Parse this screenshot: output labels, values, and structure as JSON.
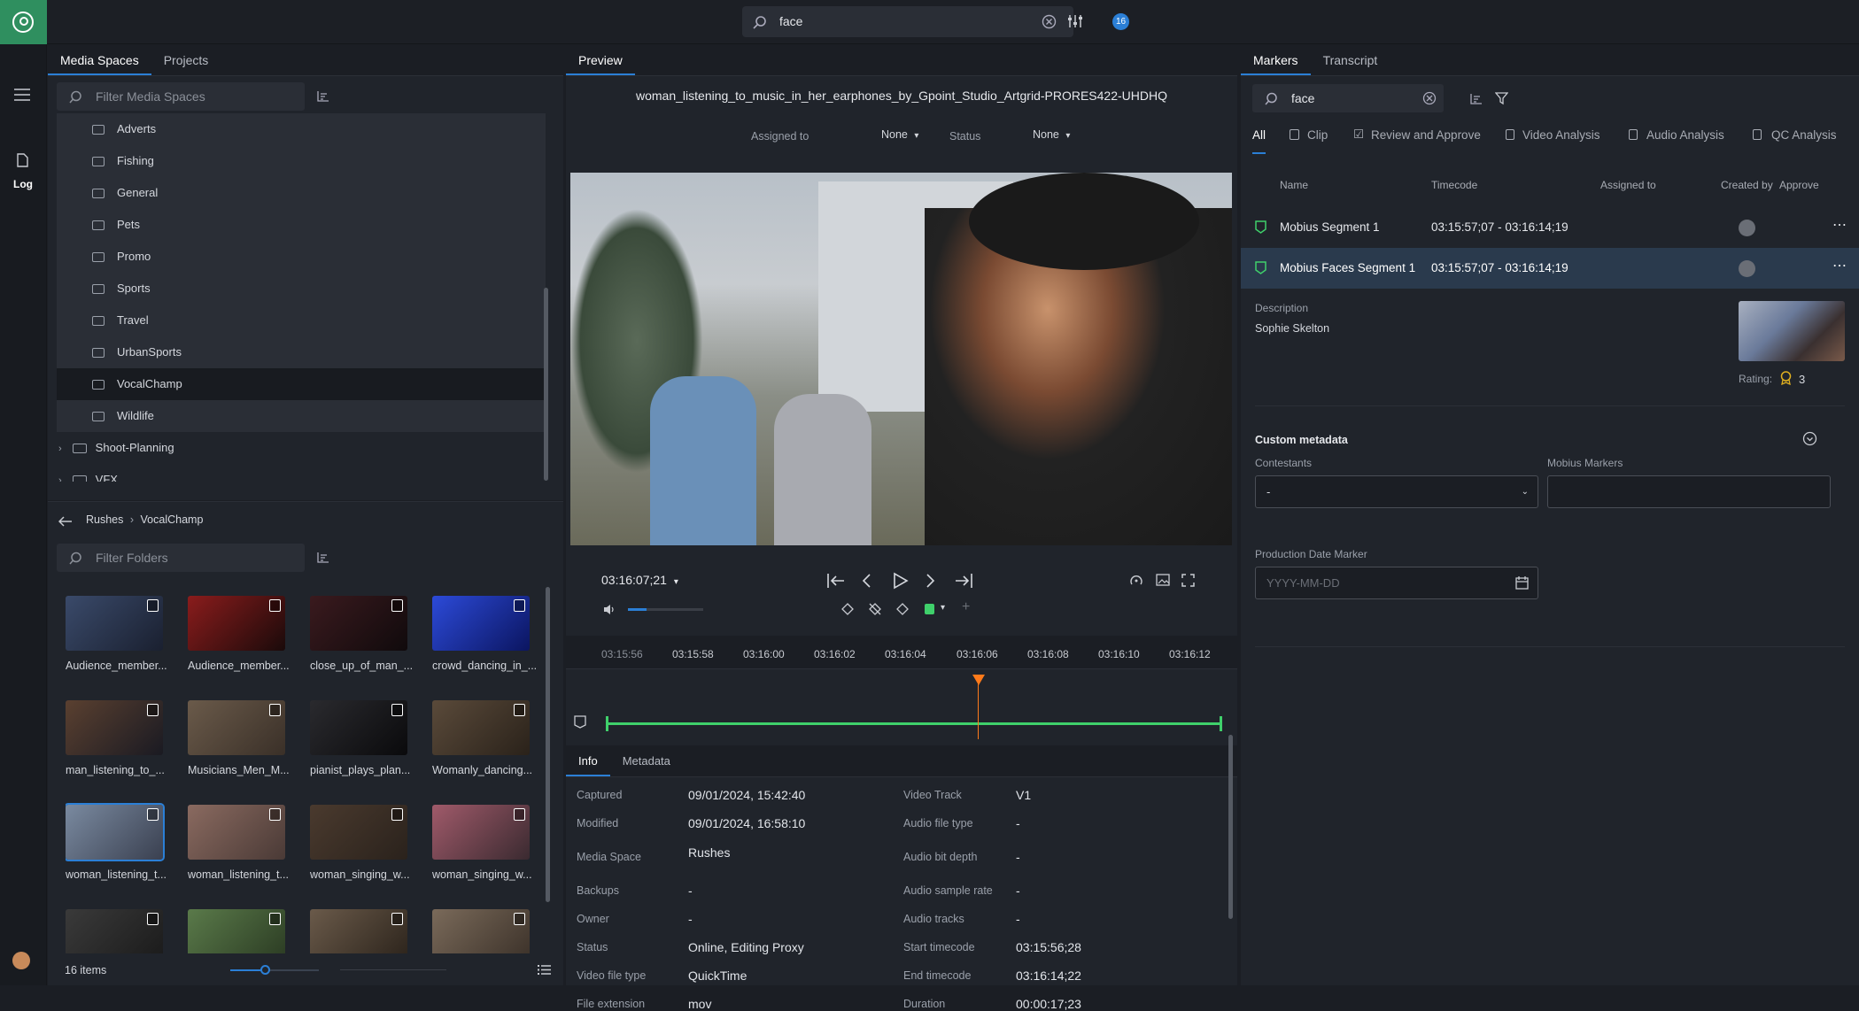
{
  "search": {
    "value": "face",
    "badge": "16"
  },
  "rail": {
    "log_label": "Log"
  },
  "left": {
    "tabs": [
      "Media Spaces",
      "Projects"
    ],
    "filter_placeholder": "Filter Media Spaces",
    "folders": [
      "Adverts",
      "Fishing",
      "General",
      "Pets",
      "Promo",
      "Sports",
      "Travel",
      "UrbanSports",
      "VocalChamp",
      "Wildlife"
    ],
    "groups": [
      "Shoot-Planning",
      "VFX"
    ],
    "breadcrumb": [
      "Rushes",
      "VocalChamp"
    ],
    "folder_filter_placeholder": "Filter Folders",
    "thumbs": [
      {
        "caption": "Audience_member...",
        "c1": "#3a4a6a",
        "c2": "#1a2030"
      },
      {
        "caption": "Audience_member...",
        "c1": "#8a1c1c",
        "c2": "#1a0a0a"
      },
      {
        "caption": "close_up_of_man_...",
        "c1": "#3a1a1e",
        "c2": "#100a0c"
      },
      {
        "caption": "crowd_dancing_in_...",
        "c1": "#2c4ad8",
        "c2": "#0b1560"
      },
      {
        "caption": "man_listening_to_...",
        "c1": "#5a4030",
        "c2": "#1a1a22"
      },
      {
        "caption": "Musicians_Men_M...",
        "c1": "#6a5a4a",
        "c2": "#3a3028"
      },
      {
        "caption": "pianist_plays_plan...",
        "c1": "#2a2a2e",
        "c2": "#0a0a0c"
      },
      {
        "caption": "Womanly_dancing...",
        "c1": "#5a4a3a",
        "c2": "#2a221a"
      },
      {
        "caption": "woman_listening_t...",
        "c1": "#7a8aa0",
        "c2": "#3a4050"
      },
      {
        "caption": "woman_listening_t...",
        "c1": "#8a6a60",
        "c2": "#4a3a36"
      },
      {
        "caption": "woman_singing_w...",
        "c1": "#4a3a2e",
        "c2": "#2a221c"
      },
      {
        "caption": "woman_singing_w...",
        "c1": "#a05a6a",
        "c2": "#3a2a30"
      },
      {
        "caption": "",
        "c1": "#3a3a3a",
        "c2": "#1a1a1a"
      },
      {
        "caption": "",
        "c1": "#5a7a4a",
        "c2": "#2a3a22"
      },
      {
        "caption": "",
        "c1": "#6a5a4a",
        "c2": "#2a221a"
      },
      {
        "caption": "",
        "c1": "#7a6a5a",
        "c2": "#3a3028"
      }
    ],
    "item_count": "16 items"
  },
  "preview": {
    "tab": "Preview",
    "title": "woman_listening_to_music_in_her_earphones_by_Gpoint_Studio_Artgrid-PRORES422-UHDHQ",
    "assigned_label": "Assigned to",
    "assigned_value": "None",
    "status_label": "Status",
    "status_value": "None",
    "timecode": "03:16:07;21",
    "ruler": [
      "03:15:56",
      "03:15:58",
      "03:16:00",
      "03:16:02",
      "03:16:04",
      "03:16:06",
      "03:16:08",
      "03:16:10",
      "03:16:12"
    ],
    "volume_level": 0.25,
    "playhead_fraction": 0.57
  },
  "info": {
    "tabs": [
      "Info",
      "Metadata"
    ],
    "left": [
      {
        "label": "Captured",
        "value": "09/01/2024, 15:42:40"
      },
      {
        "label": "Modified",
        "value": "09/01/2024, 16:58:10"
      },
      {
        "label": "Media Space",
        "value": "Rushes"
      },
      {
        "label": "Backups",
        "value": "-"
      },
      {
        "label": "Owner",
        "value": "-"
      },
      {
        "label": "Status",
        "value": "Online, Editing Proxy"
      },
      {
        "label": "Video file type",
        "value": "QuickTime"
      },
      {
        "label": "File extension",
        "value": "mov"
      }
    ],
    "right": [
      {
        "label": "Video Track",
        "value": "V1"
      },
      {
        "label": "Audio file type",
        "value": "-"
      },
      {
        "label": "Audio bit depth",
        "value": "-"
      },
      {
        "label": "Audio sample rate",
        "value": "-"
      },
      {
        "label": "Audio tracks",
        "value": "-"
      },
      {
        "label": "Start timecode",
        "value": "03:15:56;28"
      },
      {
        "label": "End timecode",
        "value": "03:16:14;22"
      },
      {
        "label": "Duration",
        "value": "00:00:17;23"
      }
    ]
  },
  "markers": {
    "tabs": [
      "Markers",
      "Transcript"
    ],
    "search": "face",
    "filters": [
      "All",
      "Clip",
      "Review and Approve",
      "Video Analysis",
      "Audio Analysis",
      "QC Analysis"
    ],
    "columns": [
      "Name",
      "Timecode",
      "Assigned to",
      "Created by",
      "Approve"
    ],
    "rows": [
      {
        "name": "Mobius Segment 1",
        "timecode": "03:15:57;07 - 03:16:14;19"
      },
      {
        "name": "Mobius Faces Segment 1",
        "timecode": "03:15:57;07 - 03:16:14;19"
      }
    ],
    "description_label": "Description",
    "description": "Sophie Skelton",
    "rating_label": "Rating:",
    "rating": "3",
    "custom_label": "Custom metadata",
    "contestants_label": "Contestants",
    "contestants_value": "-",
    "mobius_label": "Mobius Markers",
    "date_label": "Production Date Marker",
    "date_placeholder": "YYYY-MM-DD"
  }
}
